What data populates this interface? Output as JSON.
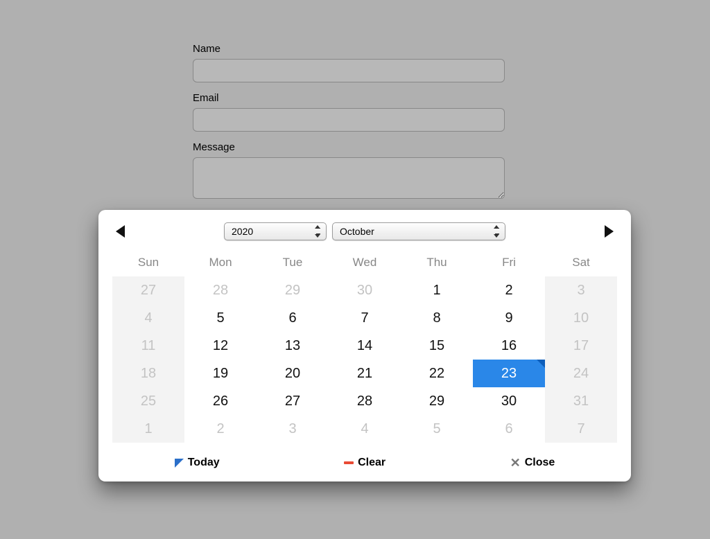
{
  "form": {
    "name_label": "Name",
    "name_value": "",
    "email_label": "Email",
    "email_value": "",
    "message_label": "Message",
    "message_value": ""
  },
  "datepicker": {
    "year": "2020",
    "month": "October",
    "weekend_columns": [
      0,
      6
    ],
    "days_of_week": [
      "Sun",
      "Mon",
      "Tue",
      "Wed",
      "Thu",
      "Fri",
      "Sat"
    ],
    "selected": {
      "row": 3,
      "col": 5
    },
    "weeks": [
      [
        {
          "d": 27,
          "in": false
        },
        {
          "d": 28,
          "in": false
        },
        {
          "d": 29,
          "in": false
        },
        {
          "d": 30,
          "in": false
        },
        {
          "d": 1,
          "in": true
        },
        {
          "d": 2,
          "in": true
        },
        {
          "d": 3,
          "in": false
        }
      ],
      [
        {
          "d": 4,
          "in": false
        },
        {
          "d": 5,
          "in": true
        },
        {
          "d": 6,
          "in": true
        },
        {
          "d": 7,
          "in": true
        },
        {
          "d": 8,
          "in": true
        },
        {
          "d": 9,
          "in": true
        },
        {
          "d": 10,
          "in": false
        }
      ],
      [
        {
          "d": 11,
          "in": false
        },
        {
          "d": 12,
          "in": true
        },
        {
          "d": 13,
          "in": true
        },
        {
          "d": 14,
          "in": true
        },
        {
          "d": 15,
          "in": true
        },
        {
          "d": 16,
          "in": true
        },
        {
          "d": 17,
          "in": false
        }
      ],
      [
        {
          "d": 18,
          "in": false
        },
        {
          "d": 19,
          "in": true
        },
        {
          "d": 20,
          "in": true
        },
        {
          "d": 21,
          "in": true
        },
        {
          "d": 22,
          "in": true
        },
        {
          "d": 23,
          "in": true
        },
        {
          "d": 24,
          "in": false
        }
      ],
      [
        {
          "d": 25,
          "in": false
        },
        {
          "d": 26,
          "in": true
        },
        {
          "d": 27,
          "in": true
        },
        {
          "d": 28,
          "in": true
        },
        {
          "d": 29,
          "in": true
        },
        {
          "d": 30,
          "in": true
        },
        {
          "d": 31,
          "in": false
        }
      ],
      [
        {
          "d": 1,
          "in": false
        },
        {
          "d": 2,
          "in": false
        },
        {
          "d": 3,
          "in": false
        },
        {
          "d": 4,
          "in": false
        },
        {
          "d": 5,
          "in": false
        },
        {
          "d": 6,
          "in": false
        },
        {
          "d": 7,
          "in": false
        }
      ]
    ],
    "footer": {
      "today": "Today",
      "clear": "Clear",
      "close": "Close"
    }
  }
}
